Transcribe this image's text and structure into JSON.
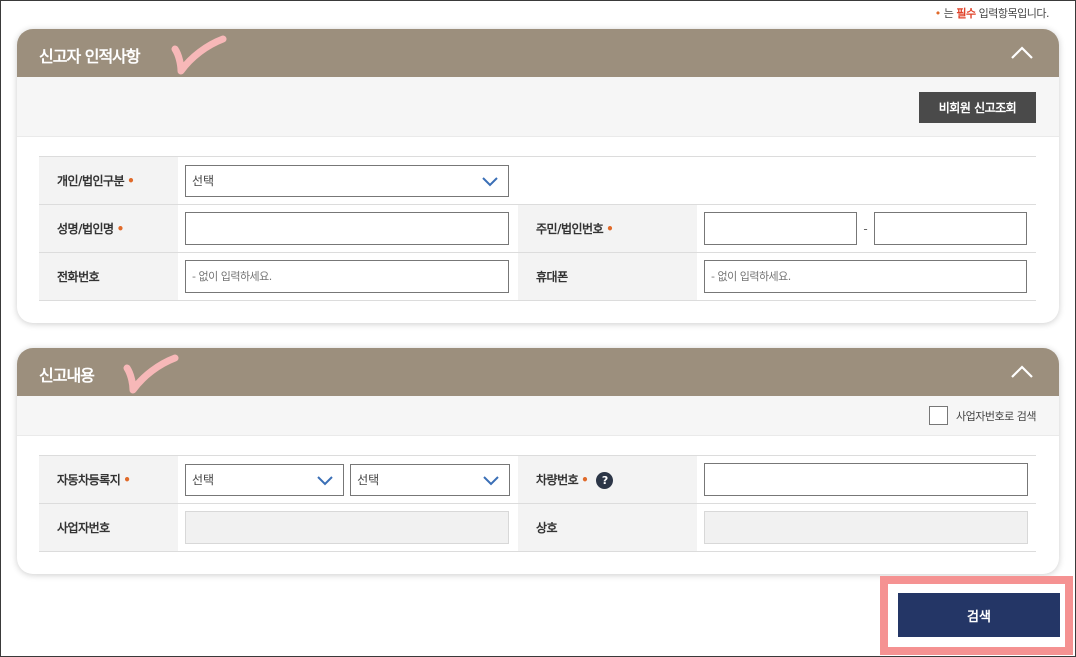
{
  "required_note": {
    "dot": "•",
    "prefix": "는",
    "must": "필수",
    "suffix": "입력항목입니다."
  },
  "colors": {
    "panel_header": "#9c8f7d",
    "required_dot": "#e06a2a",
    "check_mark": "#f7b8b8",
    "search_button": "#243666",
    "highlight": "#f59292"
  },
  "reporter": {
    "title": "신고자 인적사항",
    "lookup_button": "비회원 신고조회",
    "type_label": "개인/법인구분",
    "type_select": "선택",
    "name_label": "성명/법인명",
    "id_label": "주민/법인번호",
    "id_separator": "-",
    "phone_label": "전화번호",
    "phone_placeholder": "- 없이 입력하세요.",
    "mobile_label": "휴대폰",
    "mobile_placeholder": "- 없이 입력하세요."
  },
  "report": {
    "title": "신고내용",
    "biz_search_check": "사업자번호로 검색",
    "region_label": "자동차등록지",
    "region_select1": "선택",
    "region_select2": "선택",
    "plate_label": "차량번호",
    "help_icon": "?",
    "biz_no_label": "사업자번호",
    "company_label": "상호"
  },
  "required_mark": "•",
  "search_button": "검색"
}
